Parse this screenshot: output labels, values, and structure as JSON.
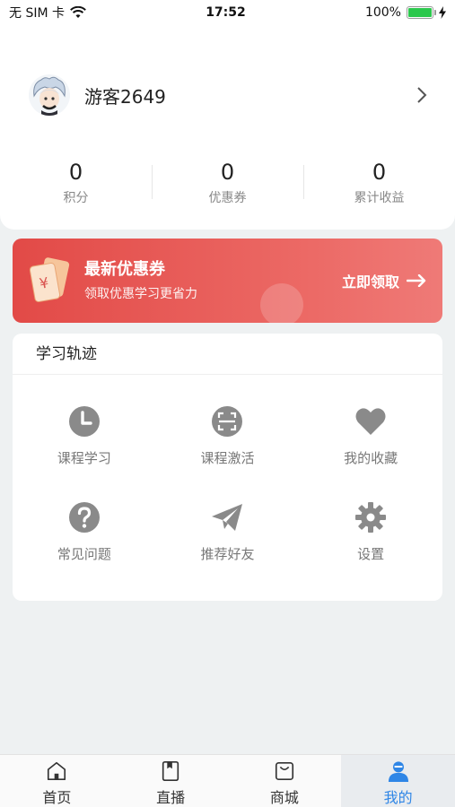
{
  "status_bar": {
    "carrier": "无 SIM 卡",
    "time": "17:52",
    "battery_text": "100%",
    "battery_level": 1.0
  },
  "profile": {
    "username": "游客2649",
    "avatar_icon": "avatar-cartoon-icon"
  },
  "stats": [
    {
      "value": "0",
      "label": "积分"
    },
    {
      "value": "0",
      "label": "优惠券"
    },
    {
      "value": "0",
      "label": "累计收益"
    }
  ],
  "coupon": {
    "title": "最新优惠券",
    "subtitle": "领取优惠学习更省力",
    "cta": "立即领取",
    "icon": "coupon-ticket-icon",
    "colors": {
      "start": "#e24a47",
      "end": "#ef7a77"
    }
  },
  "learning": {
    "title": "学习轨迹",
    "items": [
      {
        "label": "课程学习",
        "icon": "clock-icon"
      },
      {
        "label": "课程激活",
        "icon": "scan-icon"
      },
      {
        "label": "我的收藏",
        "icon": "heart-icon"
      },
      {
        "label": "常见问题",
        "icon": "question-icon"
      },
      {
        "label": "推荐好友",
        "icon": "paper-plane-icon"
      },
      {
        "label": "设置",
        "icon": "gear-icon"
      }
    ]
  },
  "tabs": [
    {
      "label": "首页",
      "icon": "home-icon",
      "active": false
    },
    {
      "label": "直播",
      "icon": "live-book-icon",
      "active": false
    },
    {
      "label": "商城",
      "icon": "shopping-bag-icon",
      "active": false
    },
    {
      "label": "我的",
      "icon": "user-icon",
      "active": true
    }
  ],
  "colors": {
    "accent": "#2f86e6",
    "icon_gray": "#8a8a8a"
  }
}
